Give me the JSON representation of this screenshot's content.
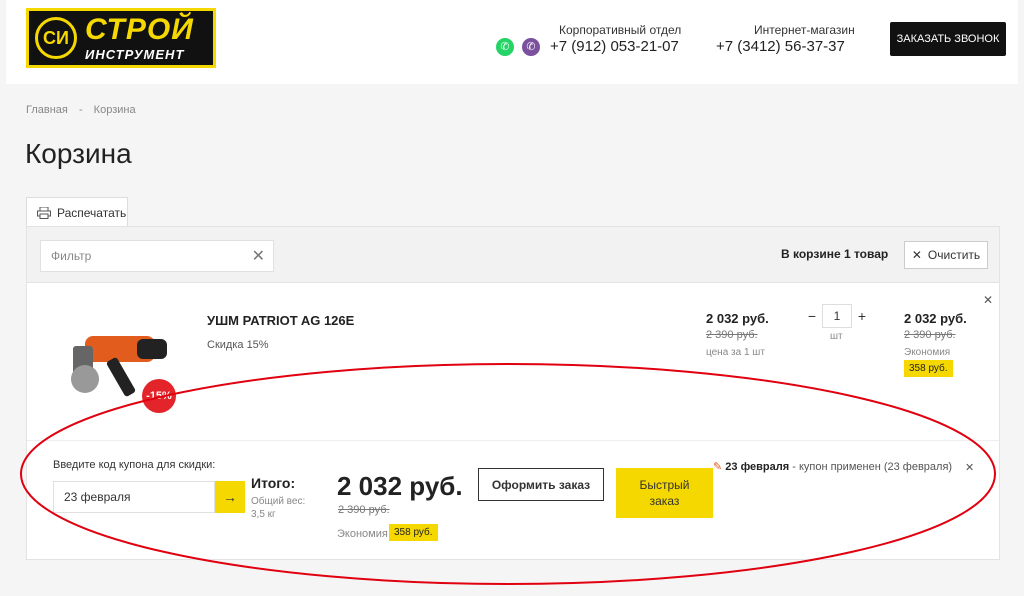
{
  "header": {
    "logo_main": "СТРОЙ",
    "logo_sub": "ИНСТРУМЕНТ",
    "logo_circle": "СИ",
    "corp_label": "Корпоративный отдел",
    "corp_phone": "+7 (912) 053-21-07",
    "shop_label": "Интернет-магазин",
    "shop_phone": "+7 (3412) 56-37-37",
    "call_button": "ЗАКАЗАТЬ ЗВОНОК"
  },
  "breadcrumb": [
    "Главная",
    "-",
    "Корзина"
  ],
  "page_title": "Корзина",
  "print_label": "Распечатать",
  "cart": {
    "filter_placeholder": "Фильтр",
    "count_text": "В корзине 1 товар",
    "clear_label": "Очистить",
    "item": {
      "name": "УШМ PATRIOT AG 126E",
      "discount_label": "Скидка",
      "discount_value": "15%",
      "badge": "-15%",
      "price": "2 032 руб.",
      "old_price": "2 390 руб.",
      "unit_label": "цена за 1 шт",
      "qty": "1",
      "qty_unit": "шт",
      "sum": "2 032 руб.",
      "sum_old": "2 390 руб.",
      "economy_label": "Экономия",
      "economy_value": "358 руб."
    },
    "coupon_label": "Введите код купона для скидки:",
    "coupon_value": "23 февраля",
    "total_label": "Итого:",
    "weight_label": "Общий вес: 3,5 кг",
    "total_price": "2 032 руб.",
    "total_old": "2 390 руб.",
    "total_economy_label": "Экономия",
    "total_economy_value": "358 руб.",
    "checkout_label": "Оформить заказ",
    "quick_label": "Быстрый заказ",
    "coupon_applied_name": "23 февраля",
    "coupon_applied_text": " - купон применен (23 февраля)"
  },
  "colors": {
    "accent": "#f5d800",
    "badge": "#e3242b",
    "annotation": "#e0000f"
  }
}
